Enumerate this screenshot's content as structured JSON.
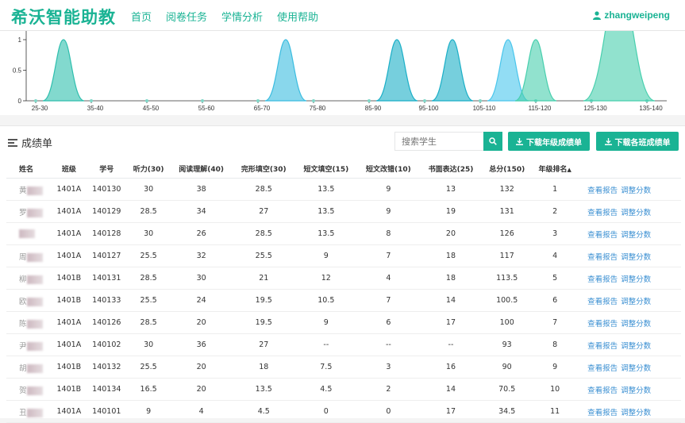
{
  "header": {
    "logo": "希沃智能助教",
    "nav": [
      "首页",
      "阅卷任务",
      "学情分析",
      "使用帮助"
    ],
    "user": "zhangweipeng"
  },
  "chart_data": {
    "type": "area",
    "x_ticks": [
      "25-30",
      "35-40",
      "45-50",
      "55-60",
      "65-70",
      "75-80",
      "85-90",
      "95-100",
      "105-110",
      "115-120",
      "125-130",
      "135-140"
    ],
    "y_ticks": [
      "0",
      "0.5",
      "1"
    ],
    "ylim": [
      0,
      1
    ],
    "curves": [
      {
        "center": "30-35",
        "peak": 1,
        "color": "#2fbfae"
      },
      {
        "center": "70-75",
        "peak": 1,
        "color": "#3bbde0"
      },
      {
        "center": "90-95",
        "peak": 1,
        "color": "#1bafc7"
      },
      {
        "center": "100-105",
        "peak": 1,
        "color": "#1bafc7"
      },
      {
        "center": "110-115",
        "peak": 1,
        "color": "#4ac6ec"
      },
      {
        "center": "115-120",
        "peak": 1,
        "color": "#48cfae"
      },
      {
        "center": "130-135",
        "peak": 2,
        "color": "#48cfae"
      }
    ],
    "colors": {
      "teal": "#1ab394",
      "blue": "#3a8fd2"
    }
  },
  "scores": {
    "title": "成绩单",
    "search_placeholder": "搜索学生",
    "download_grade": "下载年级成绩单",
    "download_class": "下载各班成绩单",
    "columns": [
      "姓名",
      "班级",
      "学号",
      "听力(30)",
      "阅读理解(40)",
      "完形填空(30)",
      "短文填空(15)",
      "短文改错(10)",
      "书面表达(25)",
      "总分(150)",
      "年级排名"
    ],
    "actions": [
      "查看报告",
      "调整分数"
    ],
    "rows": [
      {
        "name": "黄",
        "cls": "1401A",
        "id": "140130",
        "listen": "30",
        "read": "38",
        "cloze": "28.5",
        "fill": "13.5",
        "correct": "9",
        "write": "13",
        "total": "132",
        "rank": "1"
      },
      {
        "name": "罗",
        "cls": "1401A",
        "id": "140129",
        "listen": "28.5",
        "read": "34",
        "cloze": "27",
        "fill": "13.5",
        "correct": "9",
        "write": "19",
        "total": "131",
        "rank": "2"
      },
      {
        "name": "",
        "cls": "1401A",
        "id": "140128",
        "listen": "30",
        "read": "26",
        "cloze": "28.5",
        "fill": "13.5",
        "correct": "8",
        "write": "20",
        "total": "126",
        "rank": "3"
      },
      {
        "name": "周",
        "cls": "1401A",
        "id": "140127",
        "listen": "25.5",
        "read": "32",
        "cloze": "25.5",
        "fill": "9",
        "correct": "7",
        "write": "18",
        "total": "117",
        "rank": "4"
      },
      {
        "name": "柳",
        "cls": "1401B",
        "id": "140131",
        "listen": "28.5",
        "read": "30",
        "cloze": "21",
        "fill": "12",
        "correct": "4",
        "write": "18",
        "total": "113.5",
        "rank": "5"
      },
      {
        "name": "欧",
        "cls": "1401B",
        "id": "140133",
        "listen": "25.5",
        "read": "24",
        "cloze": "19.5",
        "fill": "10.5",
        "correct": "7",
        "write": "14",
        "total": "100.5",
        "rank": "6"
      },
      {
        "name": "陈",
        "cls": "1401A",
        "id": "140126",
        "listen": "28.5",
        "read": "20",
        "cloze": "19.5",
        "fill": "9",
        "correct": "6",
        "write": "17",
        "total": "100",
        "rank": "7"
      },
      {
        "name": "尹",
        "cls": "1401A",
        "id": "140102",
        "listen": "30",
        "read": "36",
        "cloze": "27",
        "fill": "--",
        "correct": "--",
        "write": "--",
        "total": "93",
        "rank": "8"
      },
      {
        "name": "胡",
        "cls": "1401B",
        "id": "140132",
        "listen": "25.5",
        "read": "20",
        "cloze": "18",
        "fill": "7.5",
        "correct": "3",
        "write": "16",
        "total": "90",
        "rank": "9"
      },
      {
        "name": "贺",
        "cls": "1401B",
        "id": "140134",
        "listen": "16.5",
        "read": "20",
        "cloze": "13.5",
        "fill": "4.5",
        "correct": "2",
        "write": "14",
        "total": "70.5",
        "rank": "10"
      },
      {
        "name": "丑",
        "cls": "1401A",
        "id": "140101",
        "listen": "9",
        "read": "4",
        "cloze": "4.5",
        "fill": "0",
        "correct": "0",
        "write": "17",
        "total": "34.5",
        "rank": "11"
      }
    ]
  }
}
